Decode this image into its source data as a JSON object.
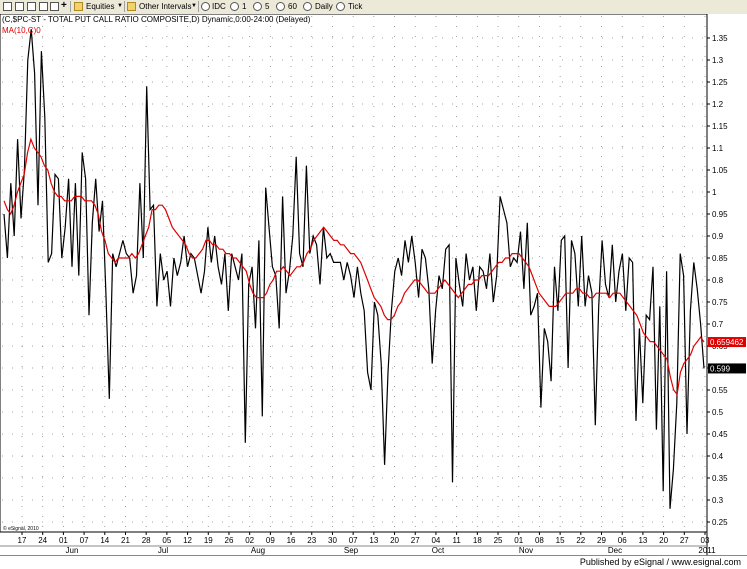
{
  "toolbar": {
    "equities": "Equities",
    "other_intervals": "Other Intervals",
    "idc": "IDC",
    "i1": "1",
    "i5": "5",
    "i60": "60",
    "daily": "Daily",
    "tick": "Tick"
  },
  "footer": {
    "published": "Published by eSignal / www.esignal.com"
  },
  "colors": {
    "price": "#000000",
    "ma": "#e00000",
    "grid": "#808080",
    "last_price_box": "#000000",
    "ma_box": "#e00000"
  },
  "chart_data": {
    "type": "line",
    "title": "(C,$PC-ST - TOTAL PUT CALL RATIO COMPOSITE,D) Dynamic,0:00-24:00 (Delayed)",
    "ma_label": "MA(10,C)",
    "ma_label_value": "0",
    "copyright": "© eSignal, 2010",
    "last_value_label": "0.599",
    "ma_value_label": "0.659462",
    "ylim": [
      0.2,
      1.38
    ],
    "y_ticks": [
      "1.35",
      "1.3",
      "1.25",
      "1.2",
      "1.15",
      "1.1",
      "1.05",
      "1",
      "0.95",
      "0.9",
      "0.85",
      "0.8",
      "0.75",
      "0.7",
      "0.65",
      "0.6",
      "0.55",
      "0.5",
      "0.45",
      "0.4",
      "0.35",
      "0.3",
      "0.25"
    ],
    "x_ticks": [
      "17",
      "24",
      "01",
      "07",
      "14",
      "21",
      "28",
      "05",
      "12",
      "19",
      "26",
      "02",
      "09",
      "16",
      "23",
      "30",
      "07",
      "13",
      "20",
      "27",
      "04",
      "11",
      "18",
      "25",
      "01",
      "08",
      "15",
      "22",
      "29",
      "06",
      "13",
      "20",
      "27",
      "03"
    ],
    "x_months": [
      "Jun",
      "Jul",
      "Aug",
      "Sep",
      "Oct",
      "Nov",
      "Dec",
      "2011"
    ],
    "series": [
      {
        "name": "$PC-ST",
        "values": [
          0.95,
          0.85,
          1.02,
          0.9,
          1.12,
          0.94,
          1.05,
          1.3,
          1.37,
          1.27,
          0.97,
          1.32,
          1.17,
          0.84,
          0.86,
          1.04,
          1.03,
          0.85,
          0.92,
          1.03,
          0.83,
          1.02,
          0.81,
          1.09,
          1.03,
          0.72,
          0.93,
          1.03,
          0.91,
          0.98,
          0.77,
          0.53,
          0.86,
          0.83,
          0.86,
          0.89,
          0.86,
          0.85,
          0.77,
          0.81,
          1.02,
          0.85,
          1.24,
          0.96,
          0.97,
          0.74,
          0.86,
          0.8,
          0.82,
          0.74,
          0.85,
          0.81,
          0.84,
          0.9,
          0.83,
          0.86,
          0.85,
          0.81,
          0.77,
          0.82,
          0.92,
          0.84,
          0.9,
          0.83,
          0.79,
          0.86,
          0.73,
          0.86,
          0.83,
          0.8,
          0.86,
          0.43,
          0.79,
          0.83,
          0.69,
          0.89,
          0.49,
          1.01,
          0.92,
          0.83,
          0.81,
          0.69,
          0.99,
          0.77,
          0.82,
          0.9,
          1.08,
          0.86,
          0.83,
          1.06,
          0.86,
          0.9,
          0.88,
          0.79,
          0.92,
          0.85,
          0.86,
          0.84,
          0.84,
          0.84,
          0.8,
          0.84,
          0.81,
          0.76,
          0.83,
          0.77,
          0.73,
          0.59,
          0.55,
          0.75,
          0.72,
          0.61,
          0.38,
          0.59,
          0.73,
          0.82,
          0.85,
          0.81,
          0.89,
          0.84,
          0.9,
          0.84,
          0.76,
          0.87,
          0.85,
          0.78,
          0.61,
          0.73,
          0.81,
          0.78,
          0.87,
          0.88,
          0.34,
          0.85,
          0.79,
          0.74,
          0.86,
          0.8,
          0.83,
          0.73,
          0.83,
          0.82,
          0.78,
          0.86,
          0.75,
          0.81,
          0.99,
          0.96,
          0.93,
          0.83,
          0.85,
          0.84,
          0.91,
          0.78,
          0.93,
          0.72,
          0.74,
          0.77,
          0.51,
          0.69,
          0.66,
          0.57,
          0.83,
          0.73,
          0.89,
          0.9,
          0.6,
          0.89,
          0.86,
          0.74,
          0.9,
          0.74,
          0.81,
          0.77,
          0.47,
          0.74,
          0.89,
          0.79,
          0.76,
          0.88,
          0.75,
          0.82,
          0.86,
          0.73,
          0.85,
          0.84,
          0.48,
          0.69,
          0.52,
          0.72,
          0.71,
          0.83,
          0.46,
          0.74,
          0.32,
          0.82,
          0.28,
          0.37,
          0.52,
          0.86,
          0.81,
          0.45,
          0.73,
          0.84,
          0.78,
          0.7,
          0.599
        ]
      },
      {
        "name": "MA(10,C)",
        "values": [
          0.98,
          0.96,
          0.95,
          0.97,
          1.0,
          1.02,
          1.04,
          1.09,
          1.12,
          1.1,
          1.09,
          1.08,
          1.06,
          1.05,
          1.02,
          1.0,
          0.99,
          0.99,
          0.98,
          0.98,
          0.98,
          0.99,
          0.99,
          0.99,
          0.98,
          0.98,
          0.98,
          0.97,
          0.95,
          0.91,
          0.89,
          0.86,
          0.85,
          0.84,
          0.85,
          0.85,
          0.85,
          0.85,
          0.86,
          0.85,
          0.86,
          0.88,
          0.9,
          0.92,
          0.96,
          0.96,
          0.97,
          0.97,
          0.96,
          0.94,
          0.92,
          0.91,
          0.9,
          0.89,
          0.88,
          0.86,
          0.85,
          0.85,
          0.86,
          0.87,
          0.89,
          0.89,
          0.88,
          0.88,
          0.87,
          0.87,
          0.86,
          0.86,
          0.85,
          0.85,
          0.84,
          0.83,
          0.82,
          0.79,
          0.77,
          0.76,
          0.76,
          0.76,
          0.77,
          0.79,
          0.8,
          0.82,
          0.82,
          0.83,
          0.82,
          0.81,
          0.82,
          0.83,
          0.83,
          0.84,
          0.86,
          0.87,
          0.89,
          0.9,
          0.91,
          0.92,
          0.91,
          0.9,
          0.89,
          0.89,
          0.88,
          0.88,
          0.87,
          0.86,
          0.86,
          0.85,
          0.84,
          0.82,
          0.8,
          0.78,
          0.76,
          0.75,
          0.74,
          0.72,
          0.71,
          0.71,
          0.72,
          0.74,
          0.75,
          0.77,
          0.78,
          0.79,
          0.8,
          0.8,
          0.79,
          0.78,
          0.77,
          0.77,
          0.77,
          0.78,
          0.79,
          0.8,
          0.79,
          0.78,
          0.77,
          0.76,
          0.77,
          0.78,
          0.79,
          0.79,
          0.8,
          0.8,
          0.81,
          0.81,
          0.81,
          0.82,
          0.83,
          0.84,
          0.84,
          0.85,
          0.85,
          0.86,
          0.86,
          0.86,
          0.85,
          0.84,
          0.83,
          0.81,
          0.79,
          0.77,
          0.76,
          0.75,
          0.74,
          0.74,
          0.74,
          0.75,
          0.76,
          0.77,
          0.77,
          0.77,
          0.78,
          0.78,
          0.77,
          0.77,
          0.76,
          0.76,
          0.77,
          0.77,
          0.77,
          0.77,
          0.76,
          0.77,
          0.77,
          0.77,
          0.76,
          0.75,
          0.74,
          0.73,
          0.72,
          0.7,
          0.68,
          0.67,
          0.66,
          0.66,
          0.65,
          0.64,
          0.63,
          0.62,
          0.58,
          0.55,
          0.54,
          0.59,
          0.61,
          0.62,
          0.63,
          0.65,
          0.66,
          0.67,
          0.659
        ]
      }
    ]
  }
}
